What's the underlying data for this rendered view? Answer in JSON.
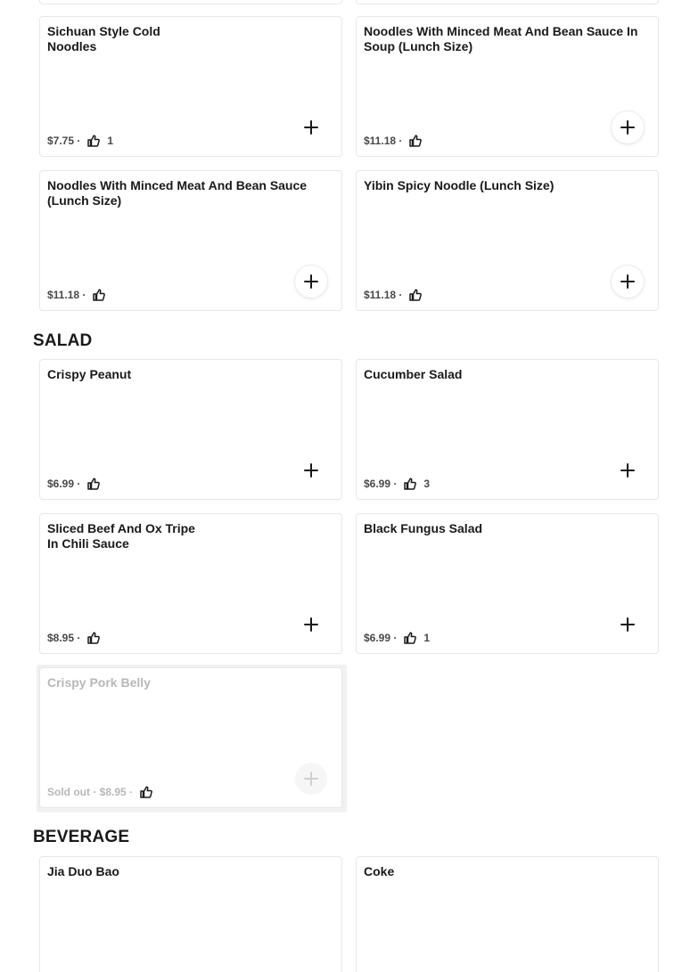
{
  "sections": {
    "salad_title": "SALAD",
    "beverage_title": "BEVERAGE"
  },
  "noodles": [
    {
      "name": "Sichuan Style Cold Noodles",
      "price": "$7.75 ·",
      "likes": "1"
    },
    {
      "name": "Noodles With Minced Meat And Bean Sauce In Soup (Lunch Size)",
      "price": "$11.18 ·",
      "likes": ""
    },
    {
      "name": "Noodles With Minced Meat And Bean Sauce (Lunch Size)",
      "price": "$11.18 ·",
      "likes": ""
    },
    {
      "name": "Yibin Spicy Noodle (Lunch Size)",
      "price": "$11.18 ·",
      "likes": ""
    }
  ],
  "salad": [
    {
      "name": "Crispy Peanut",
      "price": "$6.99 ·",
      "likes": ""
    },
    {
      "name": "Cucumber Salad",
      "price": "$6.99 ·",
      "likes": "3"
    },
    {
      "name": "Sliced Beef And Ox Tripe In Chili Sauce",
      "price": "$8.95 ·",
      "likes": ""
    },
    {
      "name": "Black Fungus Salad",
      "price": "$6.99 ·",
      "likes": "1"
    },
    {
      "name": "Crispy Pork Belly",
      "price": "Sold out · $8.95 ·",
      "likes": "",
      "sold_out": true
    }
  ],
  "beverage": [
    {
      "name": "Jia Duo Bao"
    },
    {
      "name": "Coke"
    }
  ],
  "icons": {
    "like": "thumbs-up-icon",
    "add": "plus-icon"
  },
  "colors": {
    "text": "#191919",
    "meta": "#494949",
    "muted": "#b8b8b8",
    "border": "#e7e7e7",
    "soldout_bg": "#f1f1f1"
  }
}
